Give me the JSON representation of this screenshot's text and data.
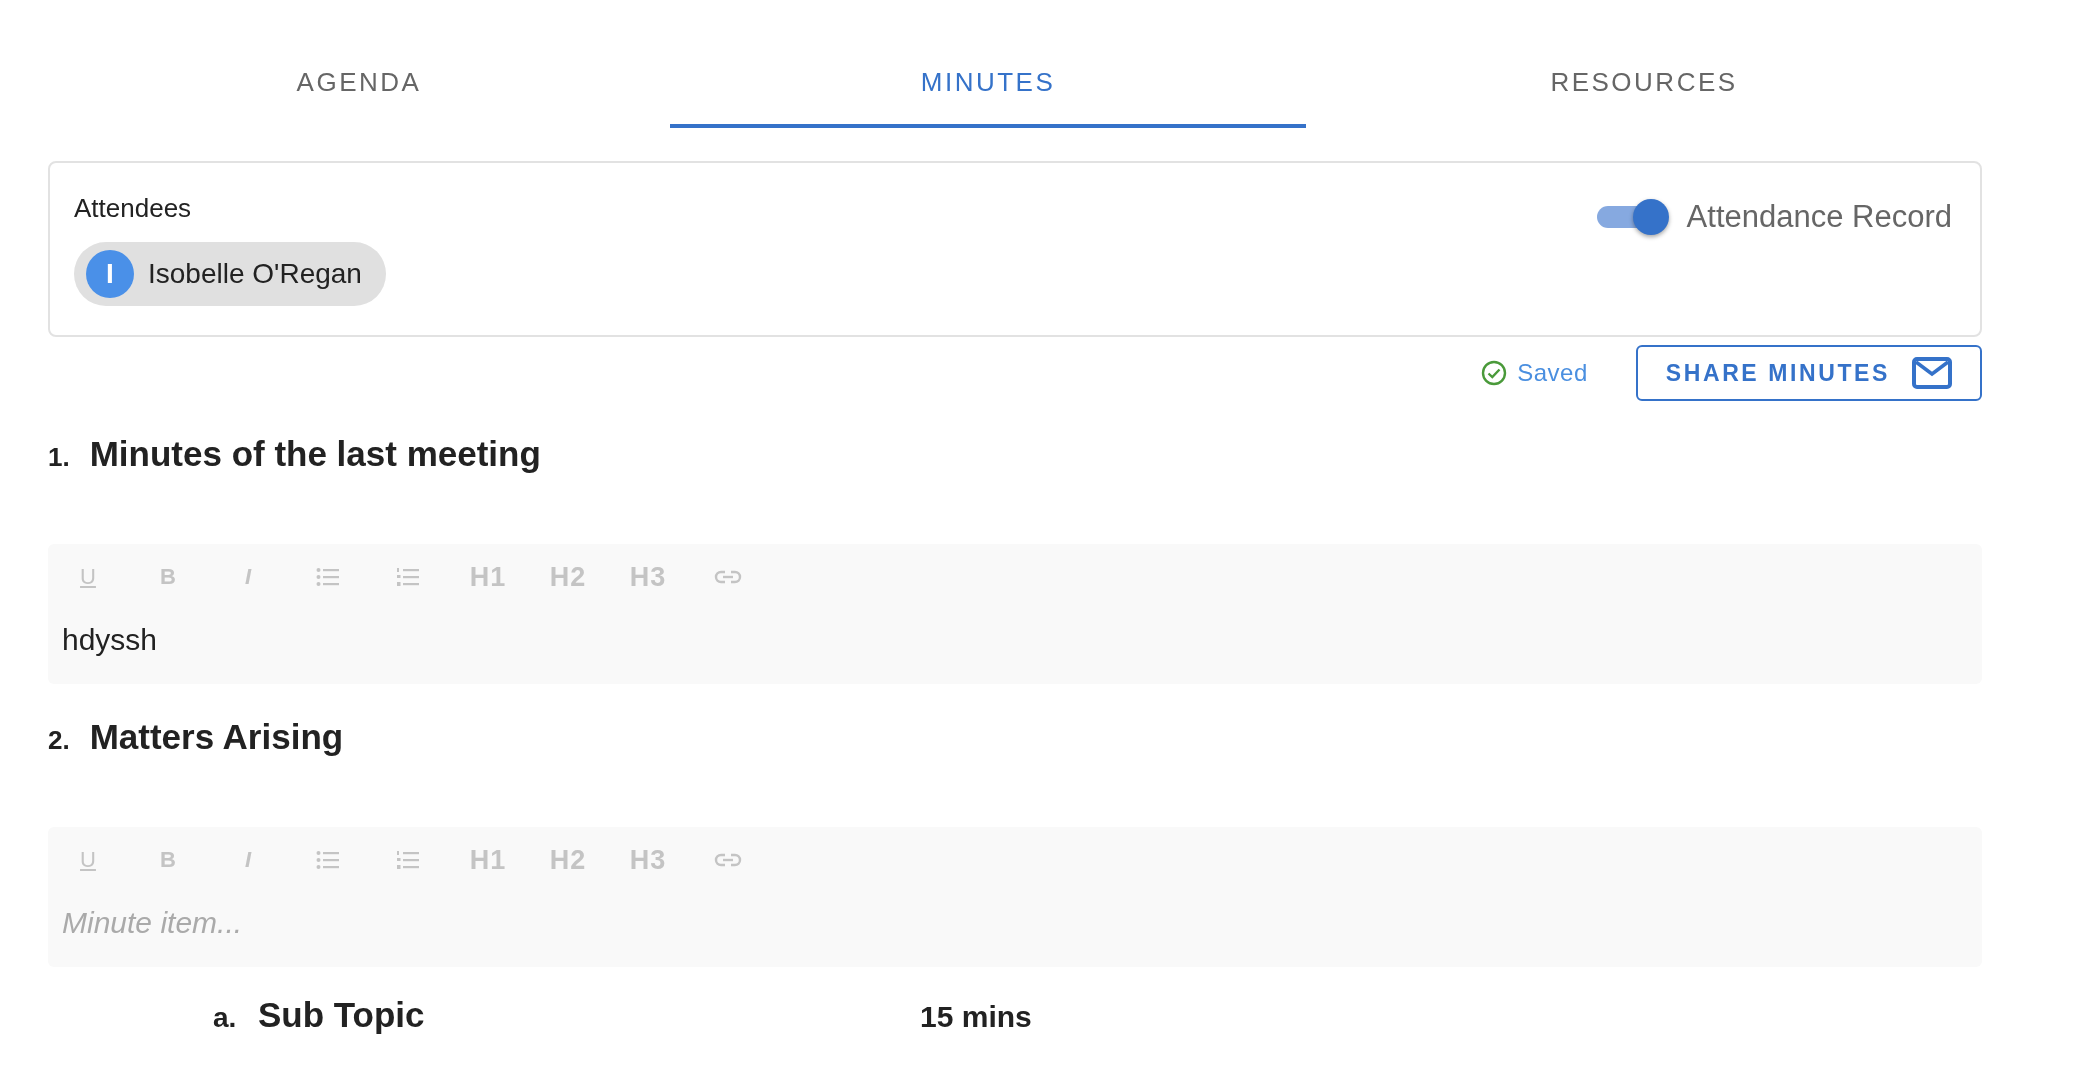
{
  "tabs": [
    {
      "label": "AGENDA",
      "selected": false
    },
    {
      "label": "MINUTES",
      "selected": true
    },
    {
      "label": "RESOURCES",
      "selected": false
    }
  ],
  "attendees": {
    "label": "Attendees",
    "chips": [
      {
        "initial": "I",
        "name": "Isobelle O'Regan"
      }
    ],
    "toggle": {
      "label": "Attendance Record",
      "on": true
    }
  },
  "save_status": "Saved",
  "share_button": "SHARE MINUTES",
  "items": [
    {
      "number": "1.",
      "title": "Minutes of the last meeting",
      "editor": {
        "toolbar": [
          {
            "kind": "underline",
            "label": "U"
          },
          {
            "kind": "bold",
            "label": "B"
          },
          {
            "kind": "italic",
            "label": "I"
          },
          {
            "kind": "bullets"
          },
          {
            "kind": "numbers"
          },
          {
            "kind": "heading",
            "label": "H1"
          },
          {
            "kind": "heading",
            "label": "H2"
          },
          {
            "kind": "heading",
            "label": "H3"
          },
          {
            "kind": "link"
          }
        ],
        "value": "hdyssh"
      }
    },
    {
      "number": "2.",
      "title": "Matters Arising",
      "editor": {
        "toolbar": [
          {
            "kind": "underline",
            "label": "U"
          },
          {
            "kind": "bold",
            "label": "B"
          },
          {
            "kind": "italic",
            "label": "I"
          },
          {
            "kind": "bullets"
          },
          {
            "kind": "numbers"
          },
          {
            "kind": "heading",
            "label": "H1"
          },
          {
            "kind": "heading",
            "label": "H2"
          },
          {
            "kind": "heading",
            "label": "H3"
          },
          {
            "kind": "link"
          }
        ],
        "placeholder": "Minute item..."
      }
    }
  ],
  "sub_items": [
    {
      "number": "a.",
      "title": "Sub Topic",
      "duration": "15 mins"
    }
  ]
}
